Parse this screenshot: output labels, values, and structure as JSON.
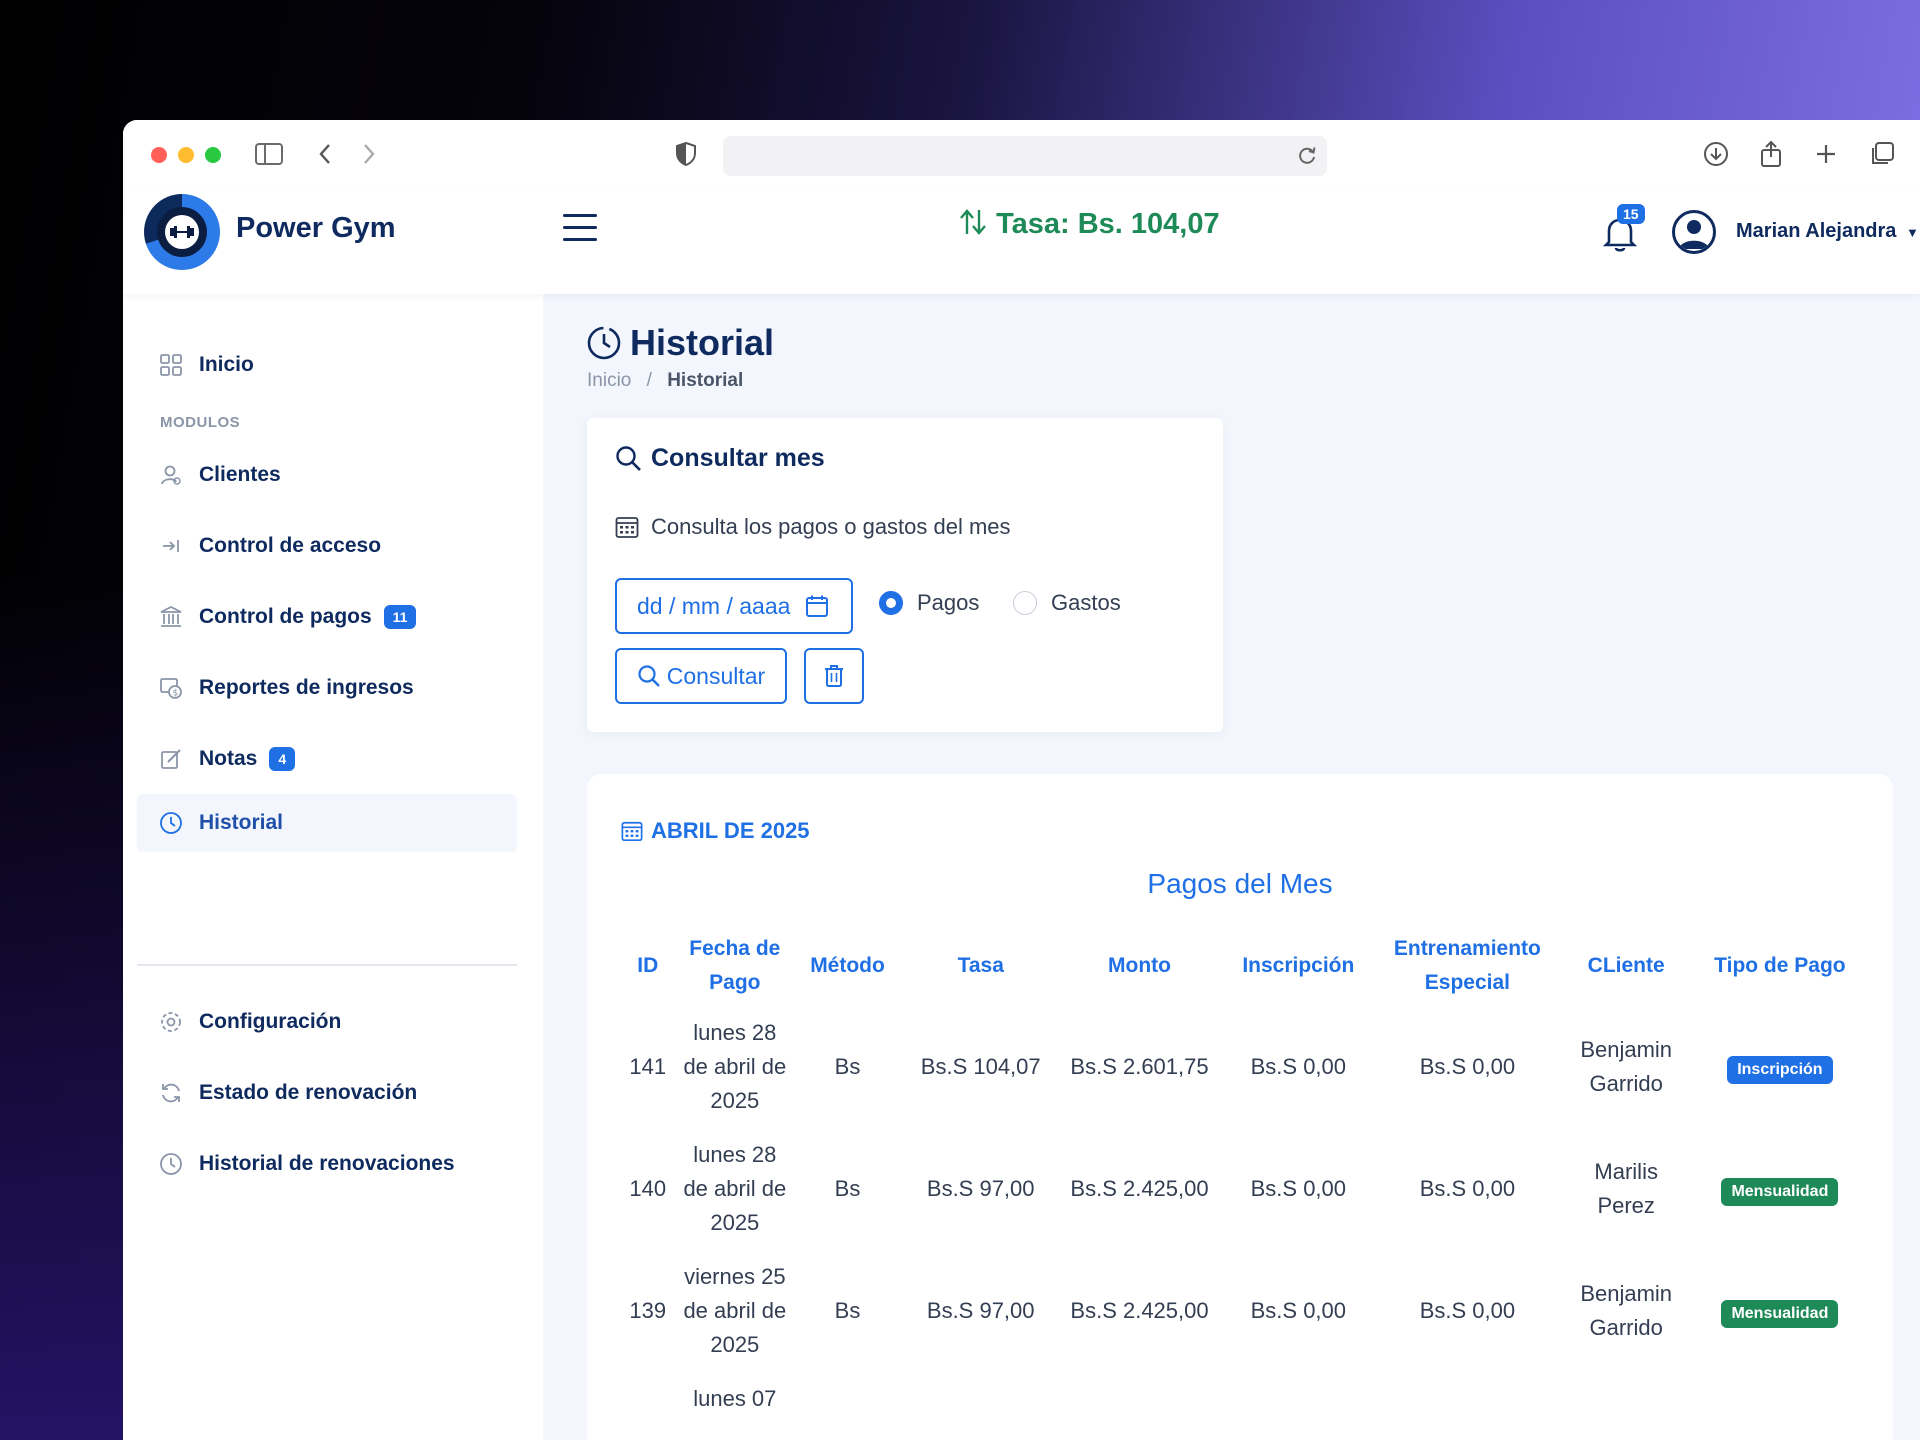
{
  "colors": {
    "brand_navy": "#0e2a5e",
    "primary_blue": "#1f6fe5",
    "rate_green": "#1e8a57",
    "inscripcion_badge": "#1f6fe5",
    "mensualidad_badge": "#1e8a57"
  },
  "header": {
    "brand": "Power Gym",
    "rate": "Tasa: Bs. 104,07",
    "notifications": "15",
    "user": "Marian Alejandra"
  },
  "sidebar": {
    "items": [
      {
        "label": "Inicio",
        "icon": "grid-icon"
      },
      {
        "label": "Clientes",
        "icon": "users-icon"
      },
      {
        "label": "Control de acceso",
        "icon": "login-arrow-icon"
      },
      {
        "label": "Control de pagos",
        "icon": "bank-icon",
        "badge": "11"
      },
      {
        "label": "Reportes de ingresos",
        "icon": "money-report-icon"
      },
      {
        "label": "Notas",
        "icon": "edit-icon",
        "badge": "4"
      },
      {
        "label": "Historial",
        "icon": "clock-icon",
        "active": true
      },
      {
        "label": "Configuración",
        "icon": "gear-icon"
      },
      {
        "label": "Estado de renovación",
        "icon": "refresh-icon"
      },
      {
        "label": "Historial de renovaciones",
        "icon": "clock-icon"
      }
    ],
    "section_label": "MODULOS"
  },
  "page": {
    "title": "Historial",
    "breadcrumb": {
      "home": "Inicio",
      "separator": "/",
      "current": "Historial"
    }
  },
  "query_card": {
    "title": "Consultar mes",
    "description": "Consulta los pagos o gastos del mes",
    "date_placeholder": "dd / mm / aaaa",
    "radio_pagos": "Pagos",
    "radio_gastos": "Gastos",
    "selected": "Pagos",
    "consult_button": "Consultar"
  },
  "results": {
    "month": "ABRIL DE 2025",
    "table_title": "Pagos del Mes",
    "columns": {
      "id": "ID",
      "fecha": "Fecha de Pago",
      "metodo": "Método",
      "tasa": "Tasa",
      "monto": "Monto",
      "inscripcion": "Inscripción",
      "entrenamiento": "Entrenamiento Especial",
      "cliente": "CLiente",
      "tipo": "Tipo de Pago"
    },
    "rows": [
      {
        "id": "141",
        "fecha": "lunes 28 de abril de 2025",
        "metodo": "Bs",
        "tasa": "Bs.S 104,07",
        "monto": "Bs.S 2.601,75",
        "inscripcion": "Bs.S 0,00",
        "entrenamiento": "Bs.S 0,00",
        "cliente": "Benjamin Garrido",
        "tipo": "Inscripción"
      },
      {
        "id": "140",
        "fecha": "lunes 28 de abril de 2025",
        "metodo": "Bs",
        "tasa": "Bs.S 97,00",
        "monto": "Bs.S 2.425,00",
        "inscripcion": "Bs.S 0,00",
        "entrenamiento": "Bs.S 0,00",
        "cliente": "Marilis Perez",
        "tipo": "Mensualidad"
      },
      {
        "id": "139",
        "fecha": "viernes 25 de abril de 2025",
        "metodo": "Bs",
        "tasa": "Bs.S 97,00",
        "monto": "Bs.S 2.425,00",
        "inscripcion": "Bs.S 0,00",
        "entrenamiento": "Bs.S 0,00",
        "cliente": "Benjamin Garrido",
        "tipo": "Mensualidad"
      },
      {
        "id": "",
        "fecha": "lunes 07",
        "metodo": "",
        "tasa": "",
        "monto": "",
        "inscripcion": "",
        "entrenamiento": "",
        "cliente": "",
        "tipo": ""
      }
    ]
  }
}
